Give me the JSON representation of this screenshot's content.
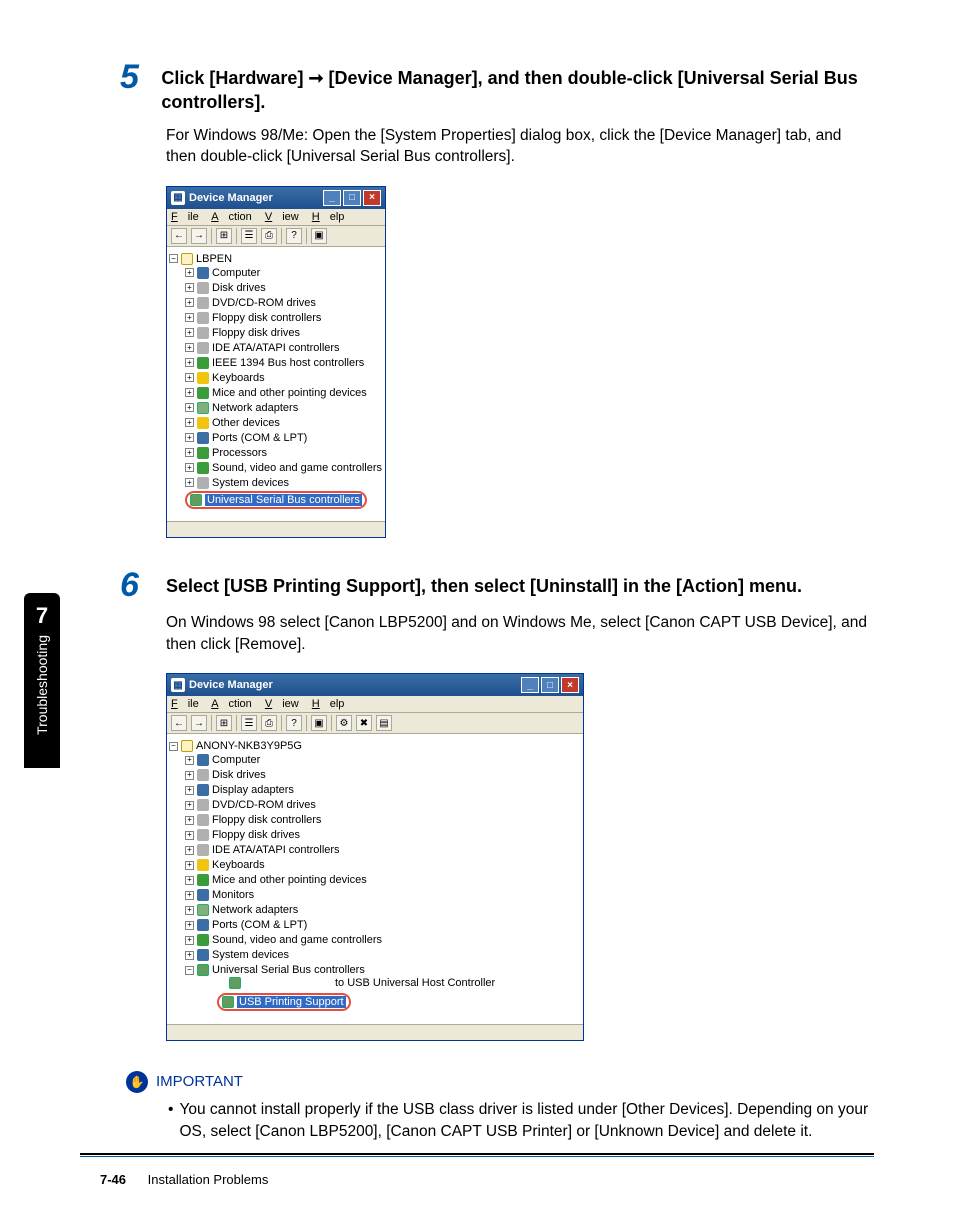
{
  "sidebar": {
    "chapter_number": "7",
    "chapter_title": "Troubleshooting"
  },
  "step5": {
    "number": "5",
    "title_a": "Click [Hardware] ",
    "title_arrow": "➞",
    "title_b": " [Device Manager], and then double-click [Universal Serial Bus controllers].",
    "body": "For Windows 98/Me: Open the [System Properties] dialog box, click the [Device Manager] tab, and then double-click [Universal Serial Bus controllers]."
  },
  "step6": {
    "number": "6",
    "title": "Select [USB Printing Support], then select [Uninstall] in the [Action] menu.",
    "body": "On Windows 98 select [Canon LBP5200] and on Windows Me, select [Canon CAPT USB Device], and then click [Remove]."
  },
  "devmgr": {
    "title": "Device Manager",
    "menu": {
      "file": "File",
      "action": "Action",
      "view": "View",
      "help": "Help"
    }
  },
  "tree1": {
    "root": "LBPEN",
    "items": [
      "Computer",
      "Disk drives",
      "DVD/CD-ROM drives",
      "Floppy disk controllers",
      "Floppy disk drives",
      "IDE ATA/ATAPI controllers",
      "IEEE 1394 Bus host controllers",
      "Keyboards",
      "Mice and other pointing devices",
      "Network adapters",
      "Other devices",
      "Ports (COM & LPT)",
      "Processors",
      "Sound, video and game controllers",
      "System devices"
    ],
    "highlight": "Universal Serial Bus controllers"
  },
  "tree2": {
    "root": "ANONY-NKB3Y9P5G",
    "items": [
      "Computer",
      "Disk drives",
      "Display adapters",
      "DVD/CD-ROM drives",
      "Floppy disk controllers",
      "Floppy disk drives",
      "IDE ATA/ATAPI controllers",
      "Keyboards",
      "Mice and other pointing devices",
      "Monitors",
      "Network adapters",
      "Ports (COM & LPT)",
      "Sound, video and game controllers",
      "System devices"
    ],
    "usb_parent": "Universal Serial Bus controllers",
    "usb_child1_trail": " to USB Universal Host Controller",
    "usb_child2": "USB Printing Support"
  },
  "important": {
    "label": "IMPORTANT",
    "bullet": "You cannot install properly if the USB class driver is listed under [Other Devices]. Depending on your OS, select [Canon LBP5200], [Canon CAPT USB Printer] or [Unknown Device] and delete it."
  },
  "footer": {
    "page": "7-46",
    "section": "Installation Problems"
  }
}
